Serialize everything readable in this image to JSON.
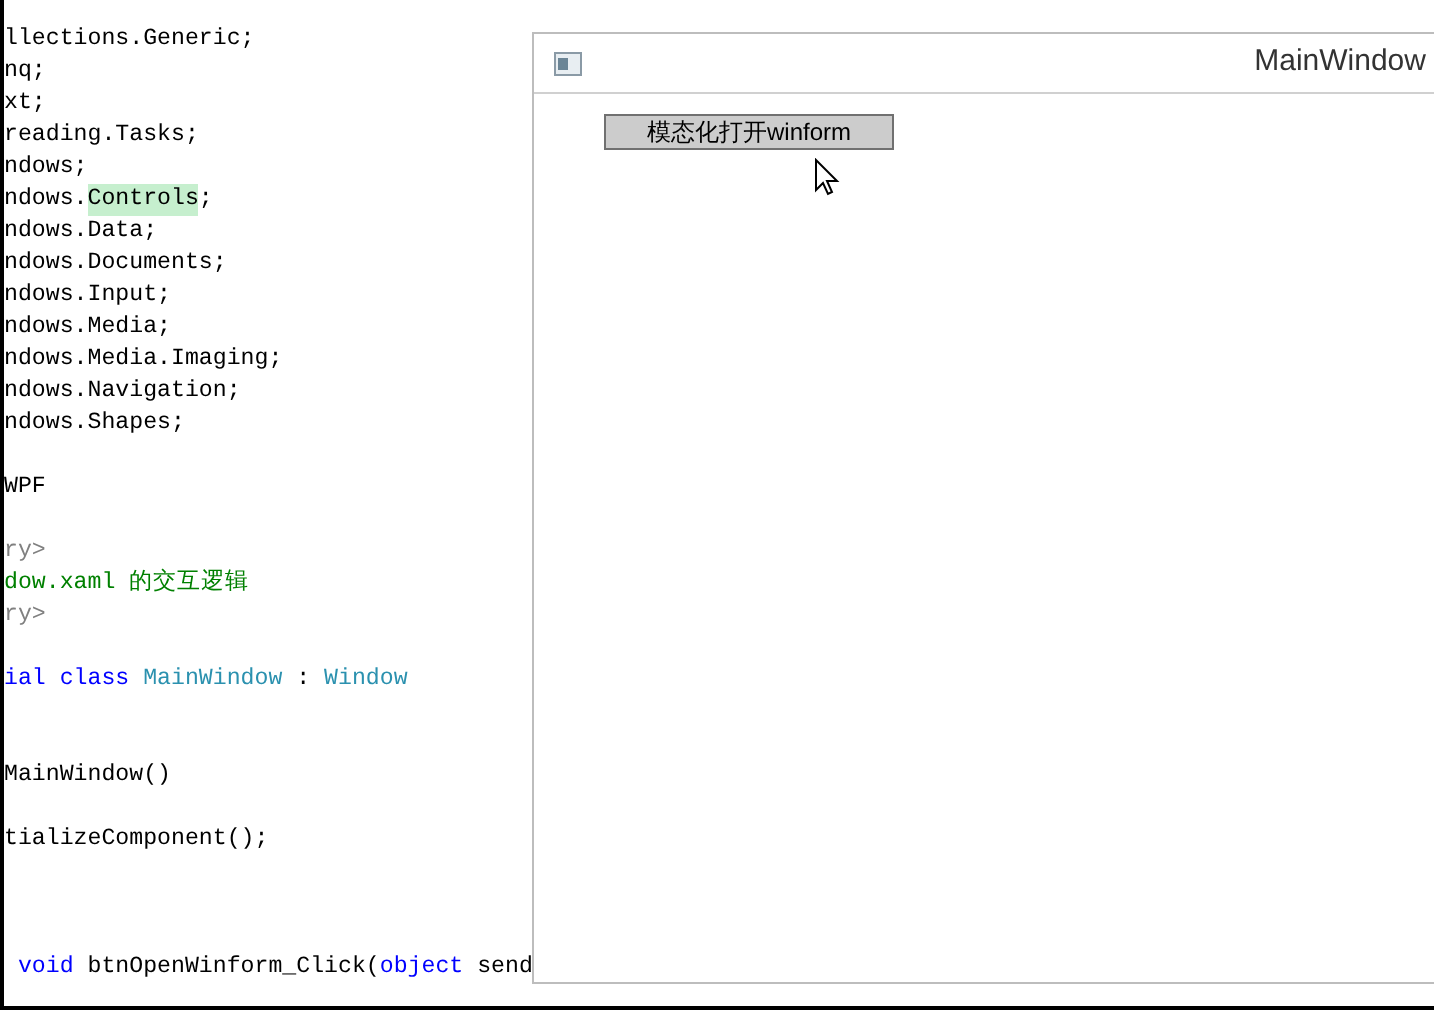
{
  "editor": {
    "lines": [
      {
        "kind": "code",
        "segments": [
          {
            "text": "llections.Generic;",
            "kind": "plain"
          }
        ]
      },
      {
        "kind": "code",
        "segments": [
          {
            "text": "nq;",
            "kind": "plain"
          }
        ]
      },
      {
        "kind": "code",
        "segments": [
          {
            "text": "xt;",
            "kind": "plain"
          }
        ]
      },
      {
        "kind": "code",
        "segments": [
          {
            "text": "reading.Tasks;",
            "kind": "plain"
          }
        ]
      },
      {
        "kind": "code",
        "segments": [
          {
            "text": "ndows;",
            "kind": "plain"
          }
        ]
      },
      {
        "kind": "code",
        "segments": [
          {
            "text": "ndows.",
            "kind": "plain"
          },
          {
            "text": "Controls",
            "kind": "highlight"
          },
          {
            "text": ";",
            "kind": "plain"
          }
        ]
      },
      {
        "kind": "code",
        "segments": [
          {
            "text": "ndows.Data;",
            "kind": "plain"
          }
        ]
      },
      {
        "kind": "code",
        "segments": [
          {
            "text": "ndows.Documents;",
            "kind": "plain"
          }
        ]
      },
      {
        "kind": "code",
        "segments": [
          {
            "text": "ndows.Input;",
            "kind": "plain"
          }
        ]
      },
      {
        "kind": "code",
        "segments": [
          {
            "text": "ndows.Media;",
            "kind": "plain"
          }
        ]
      },
      {
        "kind": "code",
        "segments": [
          {
            "text": "ndows.Media.Imaging;",
            "kind": "plain"
          }
        ]
      },
      {
        "kind": "code",
        "segments": [
          {
            "text": "ndows.Navigation;",
            "kind": "plain"
          }
        ]
      },
      {
        "kind": "code",
        "segments": [
          {
            "text": "ndows.Shapes;",
            "kind": "plain"
          }
        ]
      },
      {
        "kind": "blank"
      },
      {
        "kind": "code",
        "segments": [
          {
            "text": "WPF",
            "kind": "plain"
          }
        ]
      },
      {
        "kind": "blank"
      },
      {
        "kind": "code",
        "segments": [
          {
            "text": "ry>",
            "kind": "doc"
          }
        ]
      },
      {
        "kind": "code",
        "segments": [
          {
            "text": "dow.xaml 的交互逻辑",
            "kind": "comment"
          }
        ]
      },
      {
        "kind": "code",
        "segments": [
          {
            "text": "ry>",
            "kind": "doc"
          }
        ]
      },
      {
        "kind": "blank"
      },
      {
        "kind": "code",
        "segments": [
          {
            "text": "ial class",
            "kind": "keyword"
          },
          {
            "text": " MainWindow",
            "kind": "type"
          },
          {
            "text": " : ",
            "kind": "plain"
          },
          {
            "text": "Window",
            "kind": "type"
          }
        ]
      },
      {
        "kind": "blank"
      },
      {
        "kind": "blank"
      },
      {
        "kind": "code",
        "segments": [
          {
            "text": "MainWindow()",
            "kind": "plain"
          }
        ]
      },
      {
        "kind": "blank"
      },
      {
        "kind": "code",
        "segments": [
          {
            "text": "tializeComponent();",
            "kind": "plain"
          }
        ]
      },
      {
        "kind": "blank"
      },
      {
        "kind": "blank"
      },
      {
        "kind": "blank"
      },
      {
        "kind": "code",
        "segments": [
          {
            "text": " void",
            "kind": "keyword"
          },
          {
            "text": " btnOpenWinform_Click(",
            "kind": "plain"
          },
          {
            "text": "object",
            "kind": "keyword"
          },
          {
            "text": " send",
            "kind": "plain"
          }
        ]
      }
    ]
  },
  "window": {
    "title": "MainWindow",
    "button": "模态化打开winform"
  }
}
